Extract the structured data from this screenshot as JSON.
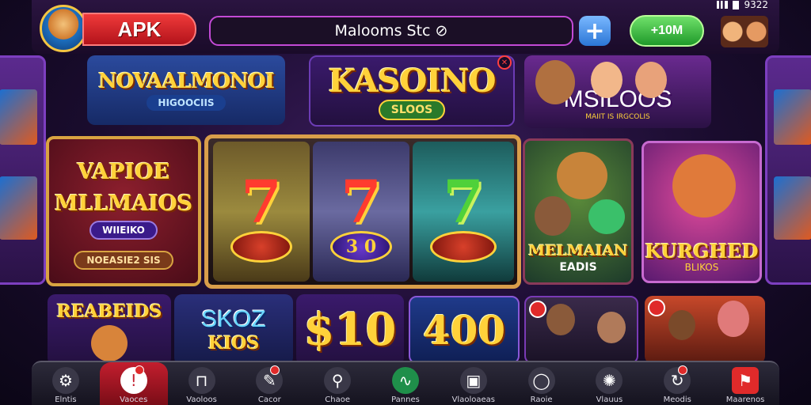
{
  "status_bar": {
    "time": "9322"
  },
  "header": {
    "brand": "APK",
    "search_text": "Malooms Stc ⊘",
    "plus": "+",
    "balance_label": "+10M"
  },
  "row1": [
    {
      "title": "NOVAALMONOI",
      "subtitle": "HIGOOCIIS"
    },
    {
      "title": "KASOINO",
      "subtitle": "SLOOS"
    },
    {
      "title": "MSILOOS",
      "subtitle": "MAIIT IS IRGCOLIS"
    }
  ],
  "row2": {
    "left": {
      "title_line1": "VAPIOE",
      "title_line2": "MLLMAIOS",
      "pill1": "WIIEIKO",
      "pill2": "NOEASIE2 SIS"
    },
    "reels": [
      {
        "symbol": "7",
        "coin": ""
      },
      {
        "symbol": "7",
        "coin": "3 0"
      },
      {
        "symbol": "7",
        "coin": ""
      }
    ],
    "card_a": {
      "title": "MELMAIAN",
      "subtitle": "EADIS"
    },
    "card_b": {
      "title": "KURGHED",
      "subtitle": "BLIKOS"
    }
  },
  "row3": [
    {
      "title": "REABEIDS"
    },
    {
      "title": "SKOZ",
      "subtitle": "KIOS"
    },
    {
      "title": "$10"
    },
    {
      "title": "400"
    },
    {
      "title": ""
    },
    {
      "title": ""
    }
  ],
  "nav": [
    {
      "icon": "gear-icon",
      "glyph": "⚙",
      "label": "Elntis"
    },
    {
      "icon": "badge-icon",
      "glyph": "!",
      "label": "Vaoces",
      "active": true
    },
    {
      "icon": "door-icon",
      "glyph": "⊓",
      "label": "Vaoloos"
    },
    {
      "icon": "edit-icon",
      "glyph": "✎",
      "label": "Cacor"
    },
    {
      "icon": "search-icon",
      "glyph": "⚲",
      "label": "Chaoe"
    },
    {
      "icon": "chart-icon",
      "glyph": "∿",
      "label": "Pannes"
    },
    {
      "icon": "gallery-icon",
      "glyph": "▣",
      "label": "Vlaoloaeas"
    },
    {
      "icon": "magnifier-icon",
      "glyph": "◯",
      "label": "Raoie"
    },
    {
      "icon": "settings-icon",
      "glyph": "✺",
      "label": "Vlauus"
    },
    {
      "icon": "refresh-icon",
      "glyph": "↻",
      "label": "Meodis"
    },
    {
      "icon": "flag-icon",
      "glyph": "⚑",
      "label": "Maarenos"
    }
  ],
  "colors": {
    "accent_red": "#c31e2e",
    "gold": "#ffd23a",
    "green": "#1f9a2a"
  }
}
